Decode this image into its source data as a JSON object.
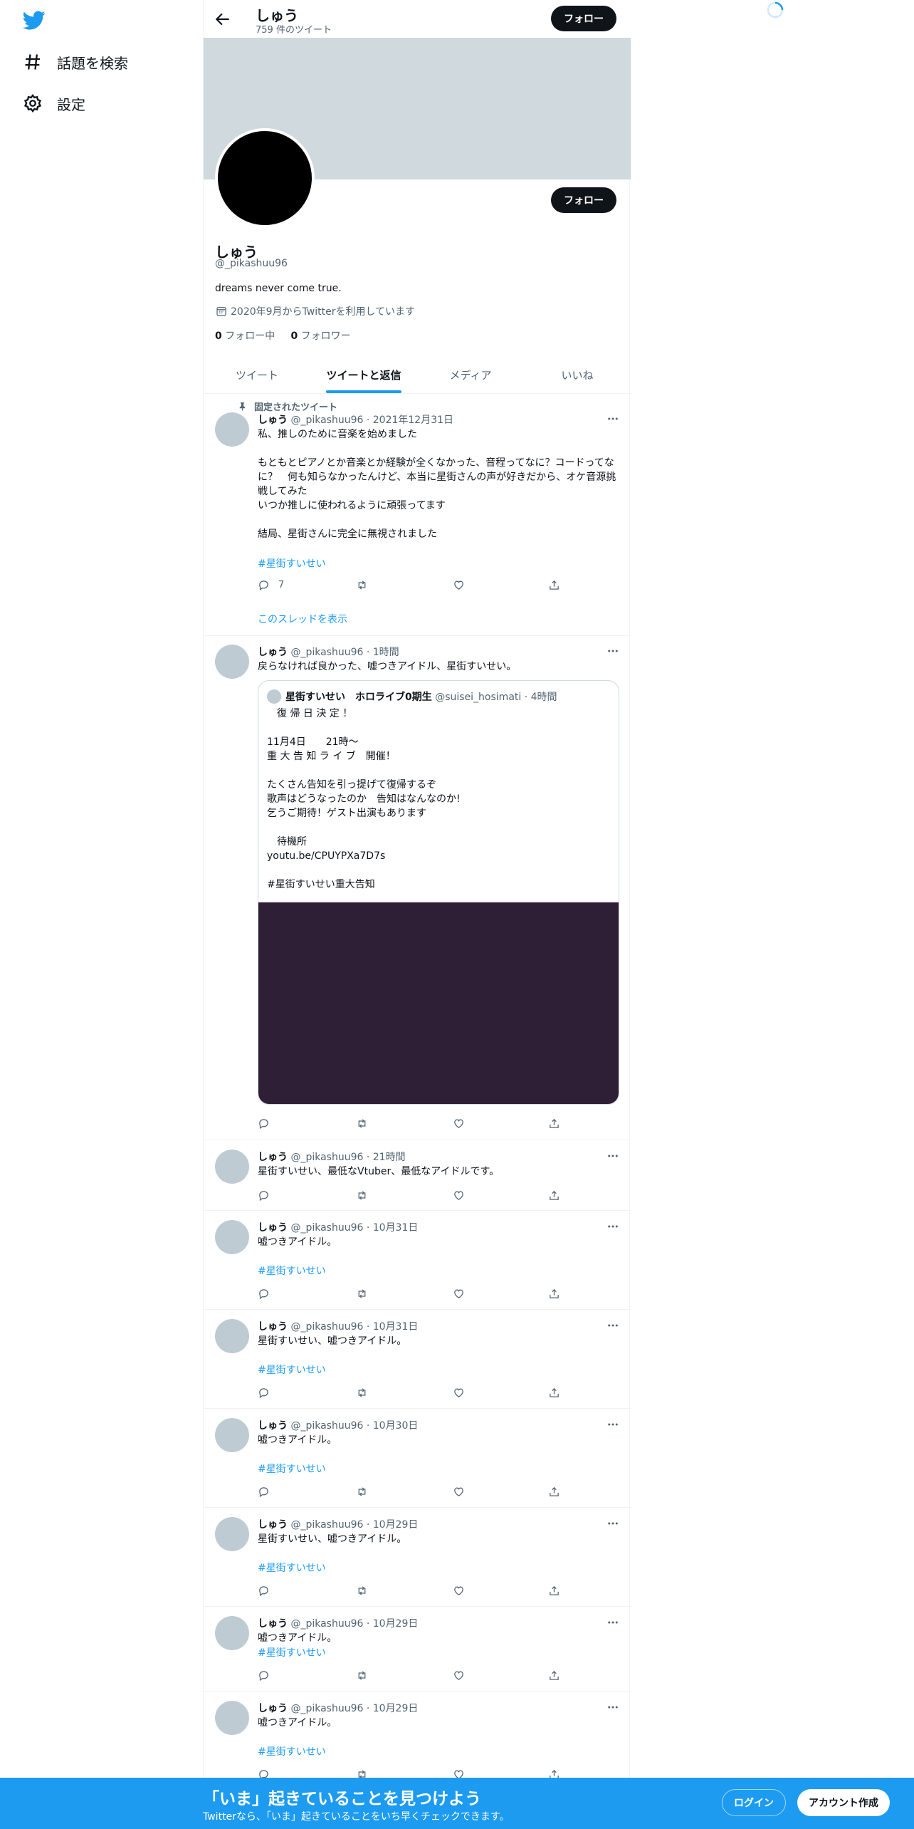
{
  "nav": {
    "items": [
      {
        "label": "話題を検索",
        "icon": "hashtag-icon"
      },
      {
        "label": "設定",
        "icon": "gear-icon"
      }
    ]
  },
  "header": {
    "name": "しゅう",
    "tweet_count": "759 件のツイート",
    "follow_label": "フォロー"
  },
  "profile": {
    "name": "しゅう",
    "handle": "@_pikashuu96",
    "bio": "dreams never come true.",
    "joined": "2020年9月からTwitterを利用しています",
    "following_count": "0",
    "following_label": "フォロー中",
    "followers_count": "0",
    "followers_label": "フォロワー",
    "follow_label": "フォロー"
  },
  "tabs": [
    {
      "label": "ツイート",
      "active": false
    },
    {
      "label": "ツイートと返信",
      "active": true
    },
    {
      "label": "メディア",
      "active": false
    },
    {
      "label": "いいね",
      "active": false
    }
  ],
  "tweets": [
    {
      "pinned_label": "固定されたツイート",
      "name": "しゅう",
      "meta": "@_pikashuu96 · 2021年12月31日",
      "text": "私、推しのために音楽を始めました\n\nもともとピアノとか音楽とか経験が全くなかった、音程ってなに？コードってなに？　何も知らなかったんけど、本当に星街さんの声が好きだから、オケ音源挑戦してみた\nいつか推しに使われるように頑張ってます\n\n結局、星街さんに完全に無視されました",
      "hashtag": "#星街すいせい",
      "reply_count": "7",
      "show_thread": "このスレッドを表示"
    },
    {
      "name": "しゅう",
      "meta": "@_pikashuu96 · 1時間",
      "text": "戻らなければ良かった、嘘つきアイドル、星街すいせい。",
      "quote": {
        "name": "星街すいせい　ホロライブ0期生",
        "meta": "@suisei_hosimati · 4時間",
        "text": "　復 帰 日 決 定 ！\n\n11月4日　　21時～\n重 大 告 知 ラ イ ブ　開催！\n\nたくさん告知を引っ提げて復帰するぞ\n歌声はどうなったのか　告知はなんなのか!\n乞うご期待！ゲスト出演もあります\n\n　待機所\nyoutu.be/CPUYPXa7D7s\n\n#星街すいせい重大告知"
      }
    },
    {
      "name": "しゅう",
      "meta": "@_pikashuu96 · 21時間",
      "text": "星街すいせい、最低なVtuber、最低なアイドルです。"
    },
    {
      "name": "しゅう",
      "meta": "@_pikashuu96 · 10月31日",
      "text": "嘘つきアイドル。",
      "hashtag": "#星街すいせい"
    },
    {
      "name": "しゅう",
      "meta": "@_pikashuu96 · 10月31日",
      "text": "星街すいせい、嘘つきアイドル。",
      "hashtag": "#星街すいせい"
    },
    {
      "name": "しゅう",
      "meta": "@_pikashuu96 · 10月30日",
      "text": "嘘つきアイドル。",
      "hashtag": "#星街すいせい"
    },
    {
      "name": "しゅう",
      "meta": "@_pikashuu96 · 10月29日",
      "text": "星街すいせい、嘘つきアイドル。",
      "hashtag": "#星街すいせい"
    },
    {
      "name": "しゅう",
      "meta": "@_pikashuu96 · 10月29日",
      "text": "嘘つきアイドル。",
      "hashtag": "#星街すいせい"
    },
    {
      "name": "しゅう",
      "meta": "@_pikashuu96 · 10月29日",
      "text": "嘘つきアイドル。",
      "hashtag": "#星街すいせい"
    }
  ],
  "bottom_bar": {
    "title": "「いま」起きていることを見つけよう",
    "subtitle": "Twitterなら、「いま」起きていることをいち早くチェックできます。",
    "login_label": "ログイン",
    "signup_label": "アカウント作成"
  },
  "colors": {
    "accent": "#1d9bf0",
    "banner": "#cfd9de",
    "media": "#2e1f36"
  }
}
